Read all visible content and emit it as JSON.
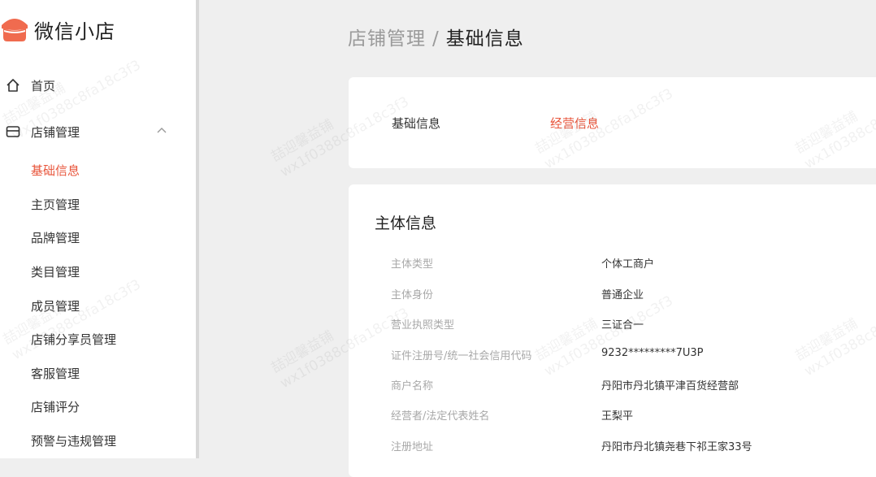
{
  "app": {
    "title": "微信小店"
  },
  "sidebar": {
    "home": {
      "label": "首页"
    },
    "store": {
      "label": "店铺管理"
    },
    "sub_items": [
      {
        "label": "基础信息",
        "active": true
      },
      {
        "label": "主页管理"
      },
      {
        "label": "品牌管理"
      },
      {
        "label": "类目管理"
      },
      {
        "label": "成员管理"
      },
      {
        "label": "店铺分享员管理"
      },
      {
        "label": "客服管理"
      },
      {
        "label": "店铺评分"
      },
      {
        "label": "预警与违规管理"
      }
    ]
  },
  "breadcrumb": {
    "parent": "店铺管理",
    "separator": "/",
    "current": "基础信息"
  },
  "tabs": [
    {
      "label": "基础信息",
      "active": false
    },
    {
      "label": "经营信息",
      "active": true
    }
  ],
  "section": {
    "title": "主体信息",
    "rows": [
      {
        "label": "主体类型",
        "value": "个体工商户"
      },
      {
        "label": "主体身份",
        "value": "普通企业"
      },
      {
        "label": "营业执照类型",
        "value": "三证合一"
      },
      {
        "label": "证件注册号/统一社会信用代码",
        "value": "9232*********7U3P"
      },
      {
        "label": "商户名称",
        "value": "丹阳市丹北镇平津百货经营部"
      },
      {
        "label": "经营者/法定代表姓名",
        "value": "王梨平"
      },
      {
        "label": "注册地址",
        "value": "丹阳市丹北镇尧巷下祁王家33号"
      }
    ]
  },
  "watermark": {
    "line1": "喆迎馨益铺",
    "line2": "wx1f0388c8fa18c3f3"
  },
  "colors": {
    "accent": "#e8553b",
    "background": "#efefef"
  }
}
